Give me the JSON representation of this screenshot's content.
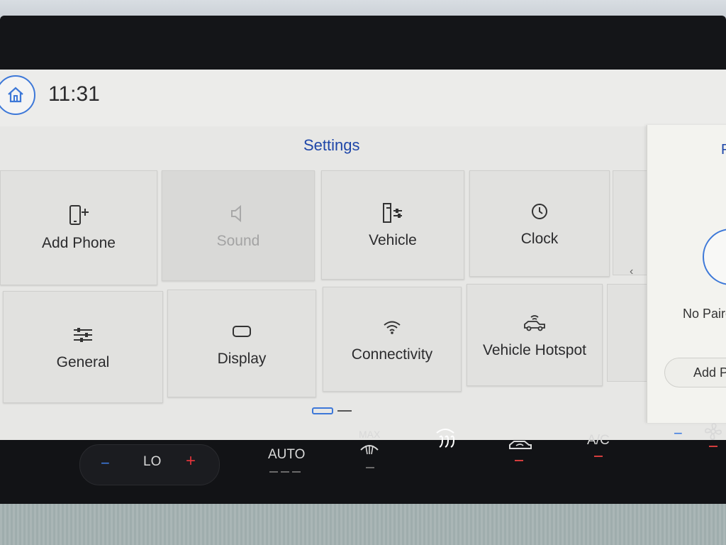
{
  "header": {
    "time": "11:31",
    "home_icon": "home-icon"
  },
  "page": {
    "title": "Settings"
  },
  "tiles": [
    {
      "label": "Add Phone",
      "icon": "add-phone-icon",
      "enabled": true
    },
    {
      "label": "Sound",
      "icon": "speaker-icon",
      "enabled": false
    },
    {
      "label": "Vehicle",
      "icon": "vehicle-settings-icon",
      "enabled": true
    },
    {
      "label": "Clock",
      "icon": "clock-icon",
      "enabled": true
    },
    {
      "label": "General",
      "icon": "sliders-icon",
      "enabled": true
    },
    {
      "label": "Display",
      "icon": "display-icon",
      "enabled": true
    },
    {
      "label": "Connectivity",
      "icon": "wifi-icon",
      "enabled": true
    },
    {
      "label": "Vehicle Hotspot",
      "icon": "hotspot-icon",
      "enabled": true
    }
  ],
  "pager": {
    "current": 1,
    "total": 2
  },
  "side_panel": {
    "title": "P",
    "status": "No Paire",
    "button": "Add P"
  },
  "climate": {
    "temp_minus": "−",
    "temp": "LO",
    "temp_plus": "+",
    "auto": "AUTO",
    "max": "MAX",
    "ac": "A/C",
    "fan_minus": "−"
  },
  "colors": {
    "accent": "#3d78d8",
    "title_blue": "#1e46a8",
    "indicator_red": "#d43d3d"
  }
}
